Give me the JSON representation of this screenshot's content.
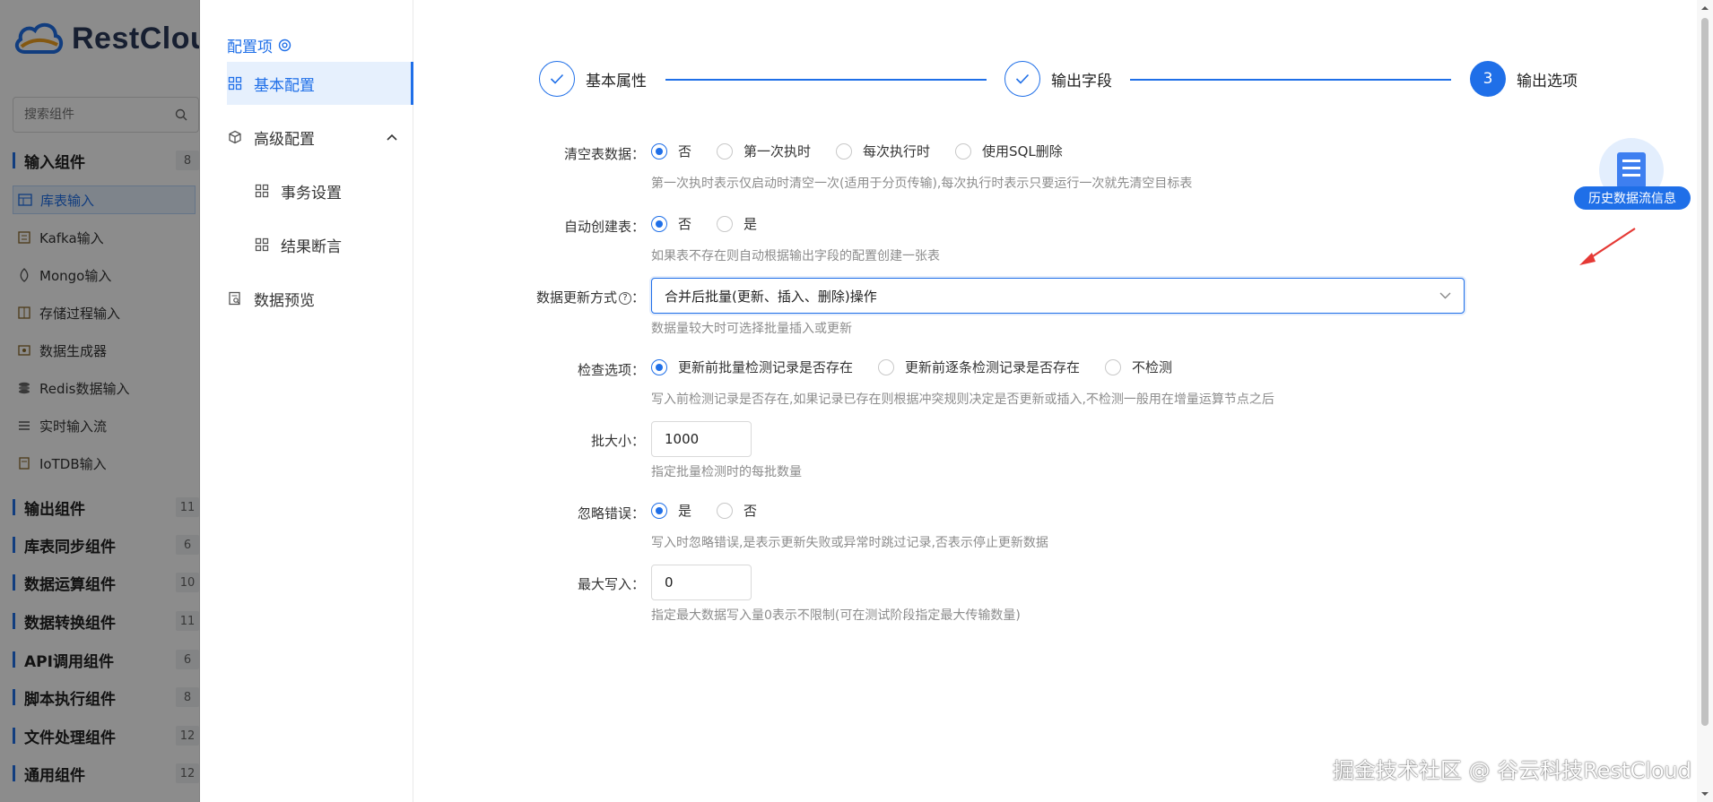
{
  "app": {
    "logo_text": "RestCloud"
  },
  "sidebar": {
    "search_placeholder": "搜索组件",
    "groups": [
      {
        "label": "输入组件",
        "count": "8"
      },
      {
        "label": "输出组件",
        "count": "11"
      },
      {
        "label": "库表同步组件",
        "count": "6"
      },
      {
        "label": "数据运算组件",
        "count": "10"
      },
      {
        "label": "数据转换组件",
        "count": "11"
      },
      {
        "label": "API调用组件",
        "count": "6"
      },
      {
        "label": "脚本执行组件",
        "count": "8"
      },
      {
        "label": "文件处理组件",
        "count": "12"
      },
      {
        "label": "通用组件",
        "count": "12"
      }
    ],
    "input_components": [
      {
        "label": "库表输入",
        "icon": "table-icon"
      },
      {
        "label": "Kafka输入",
        "icon": "kafka-icon"
      },
      {
        "label": "Mongo输入",
        "icon": "mongo-icon"
      },
      {
        "label": "存储过程输入",
        "icon": "procedure-icon"
      },
      {
        "label": "数据生成器",
        "icon": "generator-icon"
      },
      {
        "label": "Redis数据输入",
        "icon": "redis-icon"
      },
      {
        "label": "实时输入流",
        "icon": "stream-icon"
      },
      {
        "label": "IoTDB输入",
        "icon": "iotdb-icon"
      }
    ]
  },
  "config_nav": {
    "title": "配置项",
    "items": [
      {
        "label": "基本配置"
      },
      {
        "label": "高级配置"
      },
      {
        "label": "事务设置"
      },
      {
        "label": "结果断言"
      },
      {
        "label": "数据预览"
      }
    ]
  },
  "steps": [
    {
      "label": "基本属性",
      "status": "done"
    },
    {
      "label": "输出字段",
      "status": "done"
    },
    {
      "label": "输出选项",
      "status": "current",
      "number": "3"
    }
  ],
  "form": {
    "clear_table": {
      "label": "清空表数据：",
      "options": [
        "否",
        "第一次执时",
        "每次执行时",
        "使用SQL删除"
      ],
      "selected": "否",
      "hint": "第一次执时表示仅启动时清空一次(适用于分页传输),每次执行时表示只要运行一次就先清空目标表"
    },
    "auto_create": {
      "label": "自动创建表：",
      "options": [
        "否",
        "是"
      ],
      "selected": "否",
      "hint": "如果表不存在则自动根据输出字段的配置创建一张表"
    },
    "update_mode": {
      "label": "数据更新方式",
      "label_suffix": "：",
      "value": "合并后批量(更新、插入、删除)操作",
      "hint": "数据量较大时可选择批量插入或更新"
    },
    "check_option": {
      "label": "检查选项：",
      "options": [
        "更新前批量检测记录是否存在",
        "更新前逐条检测记录是否存在",
        "不检测"
      ],
      "selected": "更新前批量检测记录是否存在",
      "hint": "写入前检测记录是否存在,如果记录已存在则根据冲突规则决定是否更新或插入,不检测一般用在增量运算节点之后"
    },
    "batch_size": {
      "label": "批大小：",
      "value": "1000",
      "hint": "指定批量检测时的每批数量"
    },
    "ignore_error": {
      "label": "忽略错误：",
      "options": [
        "是",
        "否"
      ],
      "selected": "是",
      "hint": "写入时忽略错误,是表示更新失败或异常时跳过记录,否表示停止更新数据"
    },
    "max_write": {
      "label": "最大写入：",
      "value": "0",
      "hint": "指定最大数据写入量0表示不限制(可在测试阶段指定最大传输数量)"
    }
  },
  "history": {
    "label": "历史数据流信息"
  },
  "watermark": "掘金技术社区 @ 谷云科技RestCloud",
  "colors": {
    "primary": "#1f6fe8",
    "arrow": "#e53935"
  }
}
